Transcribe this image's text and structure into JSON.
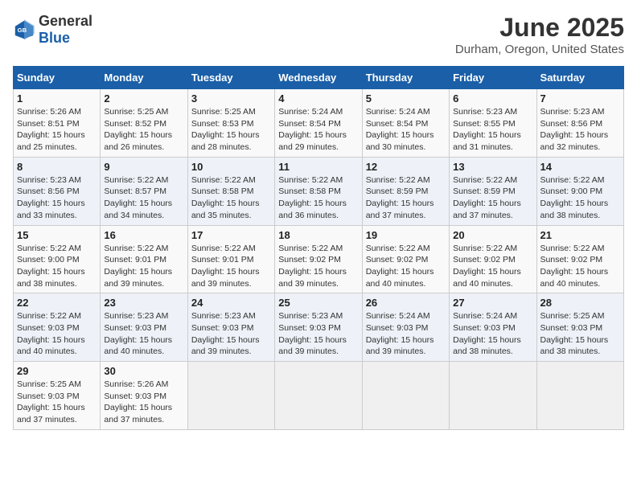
{
  "logo": {
    "general": "General",
    "blue": "Blue"
  },
  "title": "June 2025",
  "subtitle": "Durham, Oregon, United States",
  "weekdays": [
    "Sunday",
    "Monday",
    "Tuesday",
    "Wednesday",
    "Thursday",
    "Friday",
    "Saturday"
  ],
  "weeks": [
    [
      {
        "day": 1,
        "rise": "5:26 AM",
        "set": "8:51 PM",
        "daylight": "15 hours and 25 minutes."
      },
      {
        "day": 2,
        "rise": "5:25 AM",
        "set": "8:52 PM",
        "daylight": "15 hours and 26 minutes."
      },
      {
        "day": 3,
        "rise": "5:25 AM",
        "set": "8:53 PM",
        "daylight": "15 hours and 28 minutes."
      },
      {
        "day": 4,
        "rise": "5:24 AM",
        "set": "8:54 PM",
        "daylight": "15 hours and 29 minutes."
      },
      {
        "day": 5,
        "rise": "5:24 AM",
        "set": "8:54 PM",
        "daylight": "15 hours and 30 minutes."
      },
      {
        "day": 6,
        "rise": "5:23 AM",
        "set": "8:55 PM",
        "daylight": "15 hours and 31 minutes."
      },
      {
        "day": 7,
        "rise": "5:23 AM",
        "set": "8:56 PM",
        "daylight": "15 hours and 32 minutes."
      }
    ],
    [
      {
        "day": 8,
        "rise": "5:23 AM",
        "set": "8:56 PM",
        "daylight": "15 hours and 33 minutes."
      },
      {
        "day": 9,
        "rise": "5:22 AM",
        "set": "8:57 PM",
        "daylight": "15 hours and 34 minutes."
      },
      {
        "day": 10,
        "rise": "5:22 AM",
        "set": "8:58 PM",
        "daylight": "15 hours and 35 minutes."
      },
      {
        "day": 11,
        "rise": "5:22 AM",
        "set": "8:58 PM",
        "daylight": "15 hours and 36 minutes."
      },
      {
        "day": 12,
        "rise": "5:22 AM",
        "set": "8:59 PM",
        "daylight": "15 hours and 37 minutes."
      },
      {
        "day": 13,
        "rise": "5:22 AM",
        "set": "8:59 PM",
        "daylight": "15 hours and 37 minutes."
      },
      {
        "day": 14,
        "rise": "5:22 AM",
        "set": "9:00 PM",
        "daylight": "15 hours and 38 minutes."
      }
    ],
    [
      {
        "day": 15,
        "rise": "5:22 AM",
        "set": "9:00 PM",
        "daylight": "15 hours and 38 minutes."
      },
      {
        "day": 16,
        "rise": "5:22 AM",
        "set": "9:01 PM",
        "daylight": "15 hours and 39 minutes."
      },
      {
        "day": 17,
        "rise": "5:22 AM",
        "set": "9:01 PM",
        "daylight": "15 hours and 39 minutes."
      },
      {
        "day": 18,
        "rise": "5:22 AM",
        "set": "9:02 PM",
        "daylight": "15 hours and 39 minutes."
      },
      {
        "day": 19,
        "rise": "5:22 AM",
        "set": "9:02 PM",
        "daylight": "15 hours and 40 minutes."
      },
      {
        "day": 20,
        "rise": "5:22 AM",
        "set": "9:02 PM",
        "daylight": "15 hours and 40 minutes."
      },
      {
        "day": 21,
        "rise": "5:22 AM",
        "set": "9:02 PM",
        "daylight": "15 hours and 40 minutes."
      }
    ],
    [
      {
        "day": 22,
        "rise": "5:22 AM",
        "set": "9:03 PM",
        "daylight": "15 hours and 40 minutes."
      },
      {
        "day": 23,
        "rise": "5:23 AM",
        "set": "9:03 PM",
        "daylight": "15 hours and 40 minutes."
      },
      {
        "day": 24,
        "rise": "5:23 AM",
        "set": "9:03 PM",
        "daylight": "15 hours and 39 minutes."
      },
      {
        "day": 25,
        "rise": "5:23 AM",
        "set": "9:03 PM",
        "daylight": "15 hours and 39 minutes."
      },
      {
        "day": 26,
        "rise": "5:24 AM",
        "set": "9:03 PM",
        "daylight": "15 hours and 39 minutes."
      },
      {
        "day": 27,
        "rise": "5:24 AM",
        "set": "9:03 PM",
        "daylight": "15 hours and 38 minutes."
      },
      {
        "day": 28,
        "rise": "5:25 AM",
        "set": "9:03 PM",
        "daylight": "15 hours and 38 minutes."
      }
    ],
    [
      {
        "day": 29,
        "rise": "5:25 AM",
        "set": "9:03 PM",
        "daylight": "15 hours and 37 minutes."
      },
      {
        "day": 30,
        "rise": "5:26 AM",
        "set": "9:03 PM",
        "daylight": "15 hours and 37 minutes."
      },
      null,
      null,
      null,
      null,
      null
    ]
  ]
}
